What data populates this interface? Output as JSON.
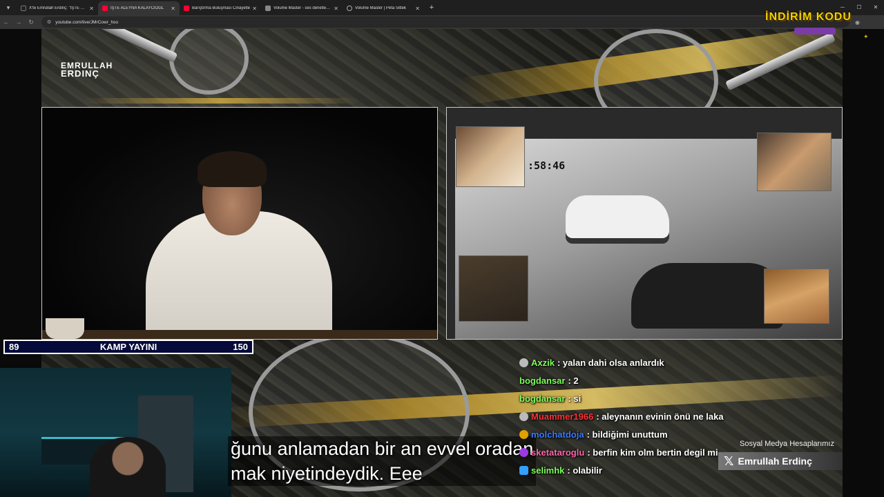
{
  "browser": {
    "tabs": [
      {
        "title": "X'te Emrullah Erdinç: \"İŞTE ALEY",
        "favicon_color": "#222222",
        "active": false
      },
      {
        "title": "İŞTE ALEYNA KALAYCIOĞL",
        "favicon_color": "#ff0033",
        "active": true
      },
      {
        "title": "Barıştırma Buluşması Cinayetle",
        "favicon_color": "#ff0033",
        "active": false
      },
      {
        "title": "Volume Master - ses denetleyici",
        "favicon_color": "#888888",
        "active": false
      },
      {
        "title": "Volume Master | Peta Sittek",
        "favicon_color": "#666666",
        "active": false
      }
    ],
    "new_tab": "+",
    "url": "youtube.com/live/JMrCowr_hso"
  },
  "stream": {
    "logo_line1": "EMRULLAH",
    "logo_line2": "ERDINÇ",
    "cctv_time": ":58:46",
    "score": {
      "left": "89",
      "title": "KAMP YAYINI",
      "right": "150"
    },
    "subtitle_line1": "ğunu anlamadan bir an evvel oradan",
    "subtitle_line2": "mak niyetindeydik. Eee",
    "promo_text": "İNDİRİM KODU",
    "chat": [
      {
        "user": "Axzik",
        "text": ": yalan dahi olsa anlardık",
        "color": "#7cff5a",
        "badge": "#bbbbbb"
      },
      {
        "user": "bogdansar",
        "text": ": 2",
        "color": "#7cff5a",
        "badge": ""
      },
      {
        "user": "bogdansar",
        "text": ": si",
        "color": "#7cff5a",
        "badge": ""
      },
      {
        "user": "Muammer1966",
        "text": ": aleynanın evinin önü ne laka",
        "color": "#ff3333",
        "badge": "#bbbbbb"
      },
      {
        "user": "molchatdoja",
        "text": ": bildiğimi unuttum",
        "color": "#3a7bff",
        "badge": "#e0a000"
      },
      {
        "user": "sketataroglu",
        "text": ": berfin kim olm bertin degil mi",
        "color": "#ff66aa",
        "badge": "#9a3ae0"
      },
      {
        "user": "selimhk",
        "text": ": olabilir",
        "color": "#7cff5a",
        "badge": "#33a0ff"
      }
    ],
    "social_header": "Sosyal Medya Hesaplarımız",
    "social_handle": "Emrullah Erdinç"
  },
  "colors": {
    "gold": "#d7b040",
    "score_bg": "#050a3a"
  }
}
